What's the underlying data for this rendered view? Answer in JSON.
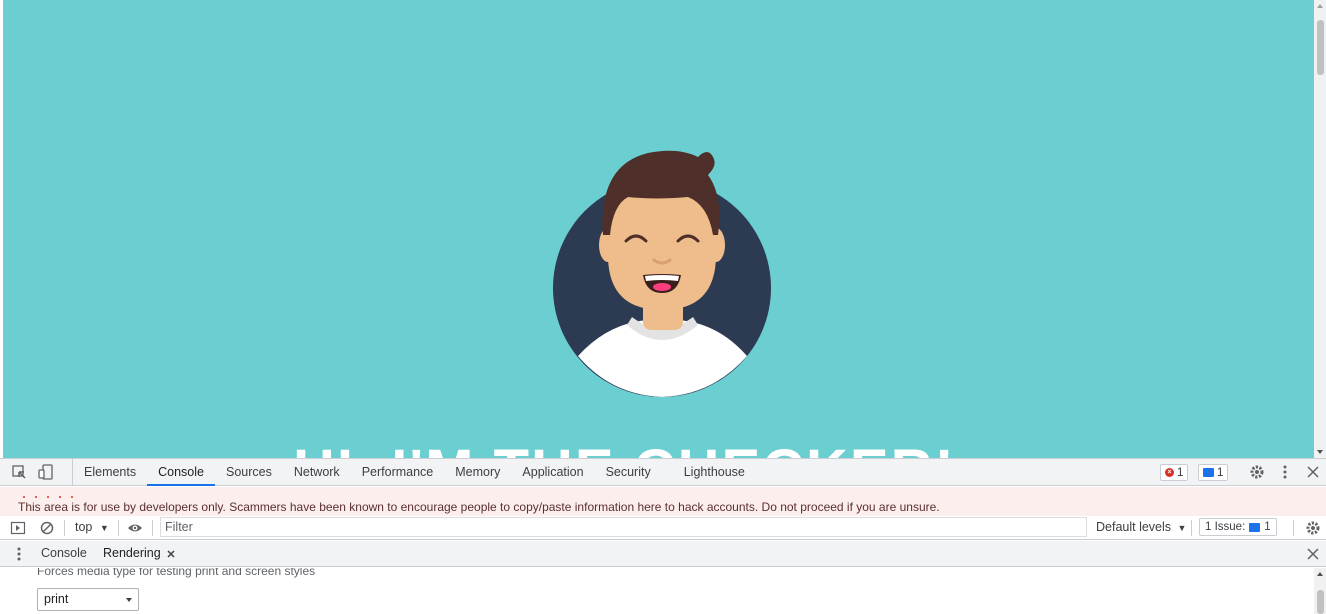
{
  "page": {
    "hero_title": "HI, I'M THE CHECKER!",
    "background_color": "#6bcfd1"
  },
  "devtools": {
    "tabs": [
      {
        "label": "Elements",
        "active": false
      },
      {
        "label": "Console",
        "active": true
      },
      {
        "label": "Sources",
        "active": false
      },
      {
        "label": "Network",
        "active": false
      },
      {
        "label": "Performance",
        "active": false
      },
      {
        "label": "Memory",
        "active": false
      },
      {
        "label": "Application",
        "active": false
      },
      {
        "label": "Security",
        "active": false
      },
      {
        "label": "Lighthouse",
        "active": false
      }
    ],
    "error_count": "1",
    "message_count": "1",
    "warning_banner": "This area is for use by developers only. Scammers have been known to encourage people to copy/paste information here to hack accounts. Do not proceed if you are unsure.",
    "console_toolbar": {
      "context": "top",
      "filter_placeholder": "Filter",
      "levels": "Default levels",
      "issues_label": "1 Issue:",
      "issues_count": "1"
    },
    "drawer": {
      "tabs": [
        {
          "label": "Console",
          "active": false
        },
        {
          "label": "Rendering",
          "active": true
        }
      ],
      "panel_description": "Forces media type for testing print and screen styles",
      "media_select_value": "print"
    },
    "accent_color": "#1a73e8",
    "error_color": "#d93025"
  }
}
